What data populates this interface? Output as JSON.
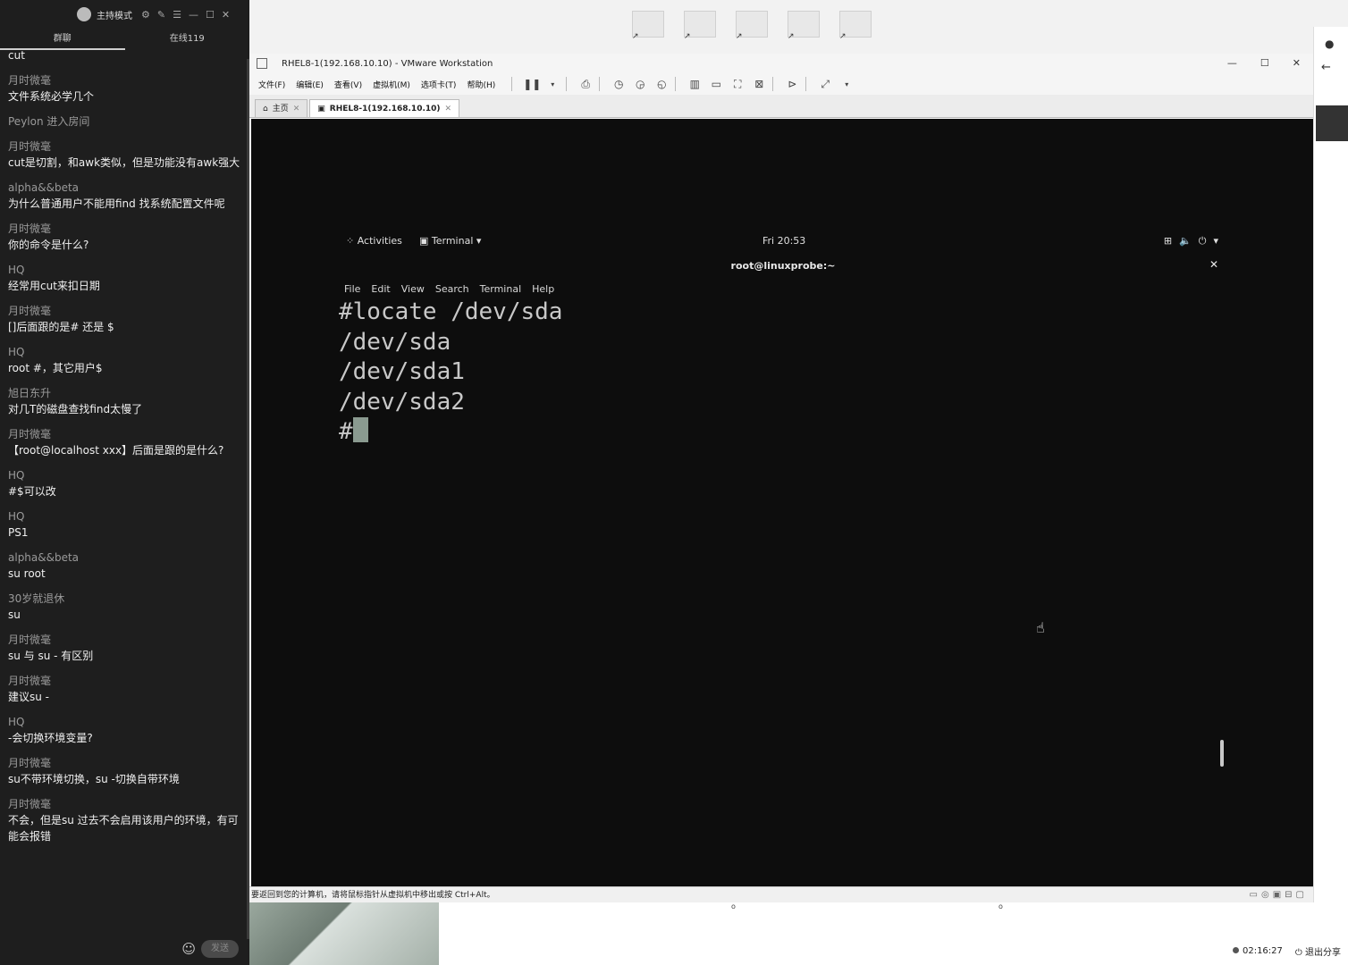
{
  "chat": {
    "mode_label": "主持模式",
    "tabs": [
      "群聊",
      "在线119"
    ],
    "messages": [
      {
        "sender": "",
        "text": "cut"
      },
      {
        "sender": "月时微毫",
        "text": "文件系统必学几个"
      },
      {
        "sender": "Peylon 进入房间",
        "text": ""
      },
      {
        "sender": "月时微毫",
        "text": "cut是切割，和awk类似，但是功能没有awk强大"
      },
      {
        "sender": "alpha&&beta",
        "text": "为什么普通用户不能用find 找系统配置文件呢"
      },
      {
        "sender": "月时微毫",
        "text": "你的命令是什么?"
      },
      {
        "sender": "HQ",
        "text": "经常用cut来扣日期"
      },
      {
        "sender": "月时微毫",
        "text": "[]后面跟的是# 还是 $"
      },
      {
        "sender": "HQ",
        "text": "root #，其它用户$"
      },
      {
        "sender": "旭日东升",
        "text": "对几T的磁盘查找find太慢了"
      },
      {
        "sender": "月时微毫",
        "text": "【root@localhost xxx】后面是跟的是什么?"
      },
      {
        "sender": "HQ",
        "text": "#$可以改"
      },
      {
        "sender": "HQ",
        "text": "PS1"
      },
      {
        "sender": "alpha&&beta",
        "text": "su root"
      },
      {
        "sender": "30岁就退休",
        "text": "su"
      },
      {
        "sender": "月时微毫",
        "text": "su 与 su - 有区别"
      },
      {
        "sender": "月时微毫",
        "text": "建议su -"
      },
      {
        "sender": "HQ",
        "text": "-会切换环境变量?"
      },
      {
        "sender": "月时微毫",
        "text": "su不带环境切换，su -切换自带环境"
      },
      {
        "sender": "月时微毫",
        "text": "不会，但是su 过去不会启用该用户的环境，有可能会报错"
      }
    ],
    "send_label": "发送"
  },
  "vmware": {
    "title": "RHEL8-1(192.168.10.10) - VMware Workstation",
    "menu": [
      "文件(F)",
      "编辑(E)",
      "查看(V)",
      "虚拟机(M)",
      "选项卡(T)",
      "帮助(H)"
    ],
    "tabs": [
      {
        "label": "主页"
      },
      {
        "label": "RHEL8-1(192.168.10.10)"
      }
    ],
    "status_text": "要返回到您的计算机，请将鼠标指针从虚拟机中移出或按 Ctrl+Alt。"
  },
  "guest": {
    "activities": "Activities",
    "app_menu": "Terminal",
    "clock": "Fri 20:53",
    "terminal_title": "root@linuxprobe:~",
    "terminal_menu": [
      "File",
      "Edit",
      "View",
      "Search",
      "Terminal",
      "Help"
    ],
    "lines": [
      "#locate /dev/sda",
      "/dev/sda",
      "/dev/sda1",
      "/dev/sda2"
    ],
    "prompt": "#"
  },
  "bottom": {
    "timer": "02:16:27",
    "exit_share": "退出分享"
  }
}
